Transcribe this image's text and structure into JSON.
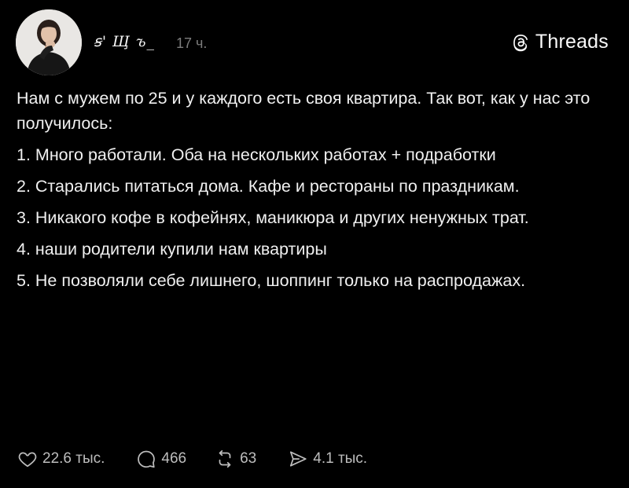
{
  "post": {
    "author": {
      "username": "ꞩ' Ш̧ ъ_",
      "avatar_icon": "profile-photo"
    },
    "time_ago": "17 ч.",
    "brand": {
      "label": "Threads",
      "icon": "threads-logo-icon"
    },
    "body": [
      "Нам с мужем по 25 и у каждого есть своя квартира. Так вот, как у нас это получилось:",
      "1. Много работали. Оба на нескольких работах + подработки",
      "2. Старались питаться дома. Кафе и рестораны по праздникам.",
      "3. Никакого кофе в кофейнях, маникюра и других ненужных трат.",
      "4. наши родители купили нам квартиры",
      "5. Не позволяли себе лишнего, шоппинг только на распродажах."
    ],
    "stats": {
      "likes": "22.6 тыс.",
      "replies": "466",
      "reposts": "63",
      "shares": "4.1 тыс."
    }
  },
  "colors": {
    "background": "#000000",
    "text": "#f0f0f0",
    "muted": "#7c7c7c",
    "icon": "#bdbdbd"
  }
}
